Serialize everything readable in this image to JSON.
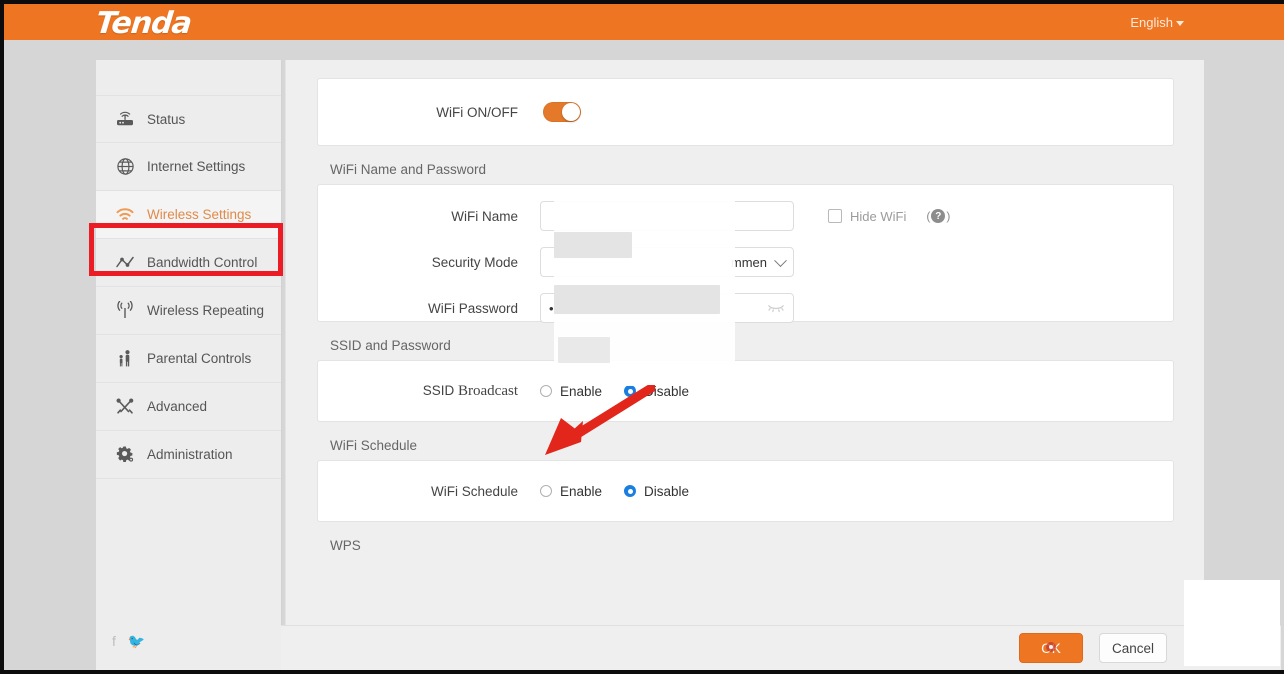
{
  "header": {
    "brand": "Tenda",
    "language": "English",
    "language_caret_icon": "caret-down-icon"
  },
  "sidebar": {
    "items": [
      {
        "label": "Status",
        "icon": "router-icon",
        "active": false
      },
      {
        "label": "Internet Settings",
        "icon": "globe-icon",
        "active": false
      },
      {
        "label": "Wireless Settings",
        "icon": "wifi-icon",
        "active": true
      },
      {
        "label": "Bandwidth Control",
        "icon": "chart-line-icon",
        "active": false
      },
      {
        "label": "Wireless Repeating",
        "icon": "signal-tower-icon",
        "active": false
      },
      {
        "label": "Parental Controls",
        "icon": "parent-child-icon",
        "active": false
      },
      {
        "label": "Advanced",
        "icon": "tools-icon",
        "active": false
      },
      {
        "label": "Administration",
        "icon": "gear-icon",
        "active": false
      }
    ],
    "social": [
      {
        "label": "f",
        "icon": "facebook-icon"
      },
      {
        "label": "🐦",
        "icon": "twitter-icon"
      }
    ]
  },
  "main": {
    "wifi_onoff": {
      "label": "WiFi ON/OFF",
      "state": "on"
    },
    "wifi_name_password": {
      "section_title": "WiFi Name and Password",
      "wifi_name_label": "WiFi Name",
      "wifi_name_value": "",
      "hide_wifi_label": "Hide WiFi",
      "hide_wifi_checked": false,
      "help_icon": "question-mark-icon",
      "security_mode_label": "Security Mode",
      "security_mode_value": "",
      "security_mode_tail": "mmen",
      "security_mode_caret_icon": "chevron-down-icon",
      "wifi_password_label": "WiFi Password",
      "wifi_password_value": "•",
      "eye_icon": "eye-slash-icon"
    },
    "ssid_section": {
      "section_title": "SSID and Password",
      "field_label_part1": "SSID ",
      "field_label_part2": "Broadcast",
      "enable_label": "Enable",
      "disable_label": "Disable",
      "selected": "Disable"
    },
    "wifi_schedule": {
      "section_title": "WiFi Schedule",
      "field_label": "WiFi Schedule",
      "enable_label": "Enable",
      "disable_label": "Disable",
      "selected": "Disable"
    },
    "wps": {
      "section_title": "WPS"
    }
  },
  "actions": {
    "ok_label": "OK",
    "cancel_label": "Cancel"
  },
  "annotations": {
    "highlight_target": "Wireless Settings",
    "highlight_color": "#ec1c24",
    "arrow_color": "#e2261c",
    "arrow_points_to": "SSID Broadcast Enable radio"
  },
  "colors": {
    "brand_orange": "#ee7623",
    "radio_blue": "#1a7ee0",
    "page_bg": "#d6d6d6",
    "panel_bg": "#efefef"
  }
}
